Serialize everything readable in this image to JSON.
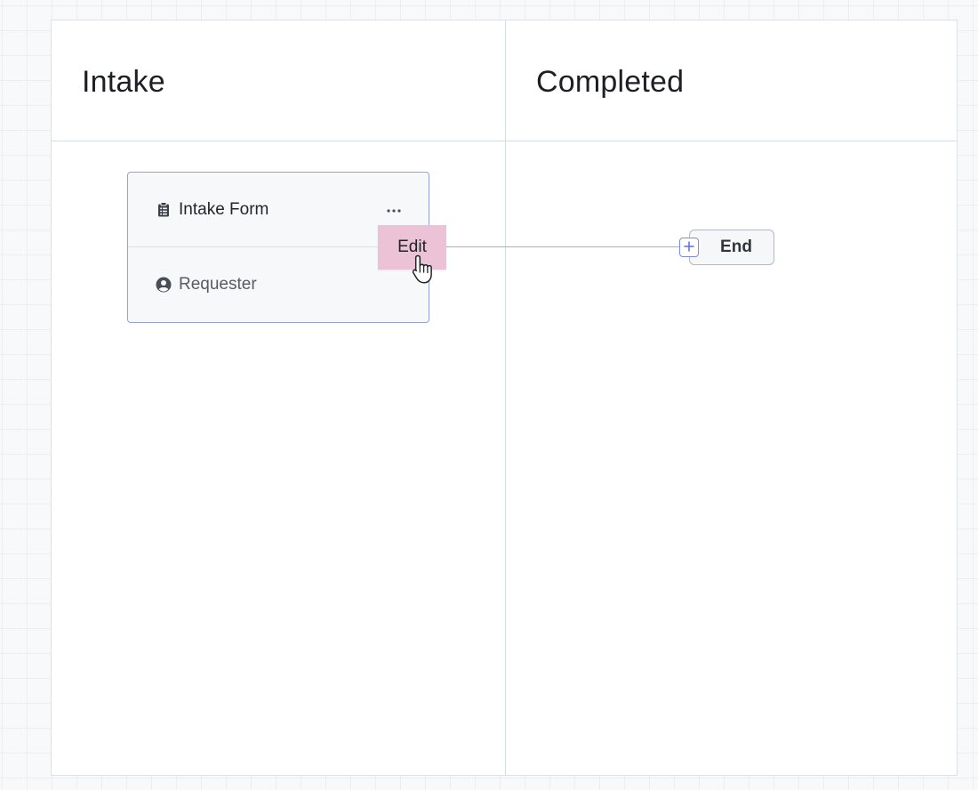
{
  "lanes": [
    {
      "title": "Intake"
    },
    {
      "title": "Completed"
    }
  ],
  "task_card": {
    "title": "Intake Form",
    "title_icon": "clipboard-icon",
    "menu_icon": "more-horizontal-icon",
    "role": "Requester",
    "role_icon": "user-circle-icon"
  },
  "edit_button": {
    "label": "Edit"
  },
  "end_node": {
    "label": "End",
    "add_icon": "plus-icon"
  },
  "colors": {
    "card_border": "#8fa2e6",
    "edit_highlight": "#ecc2d6",
    "add_button_border": "#7d8ae6",
    "connector": "#aab0c4"
  }
}
